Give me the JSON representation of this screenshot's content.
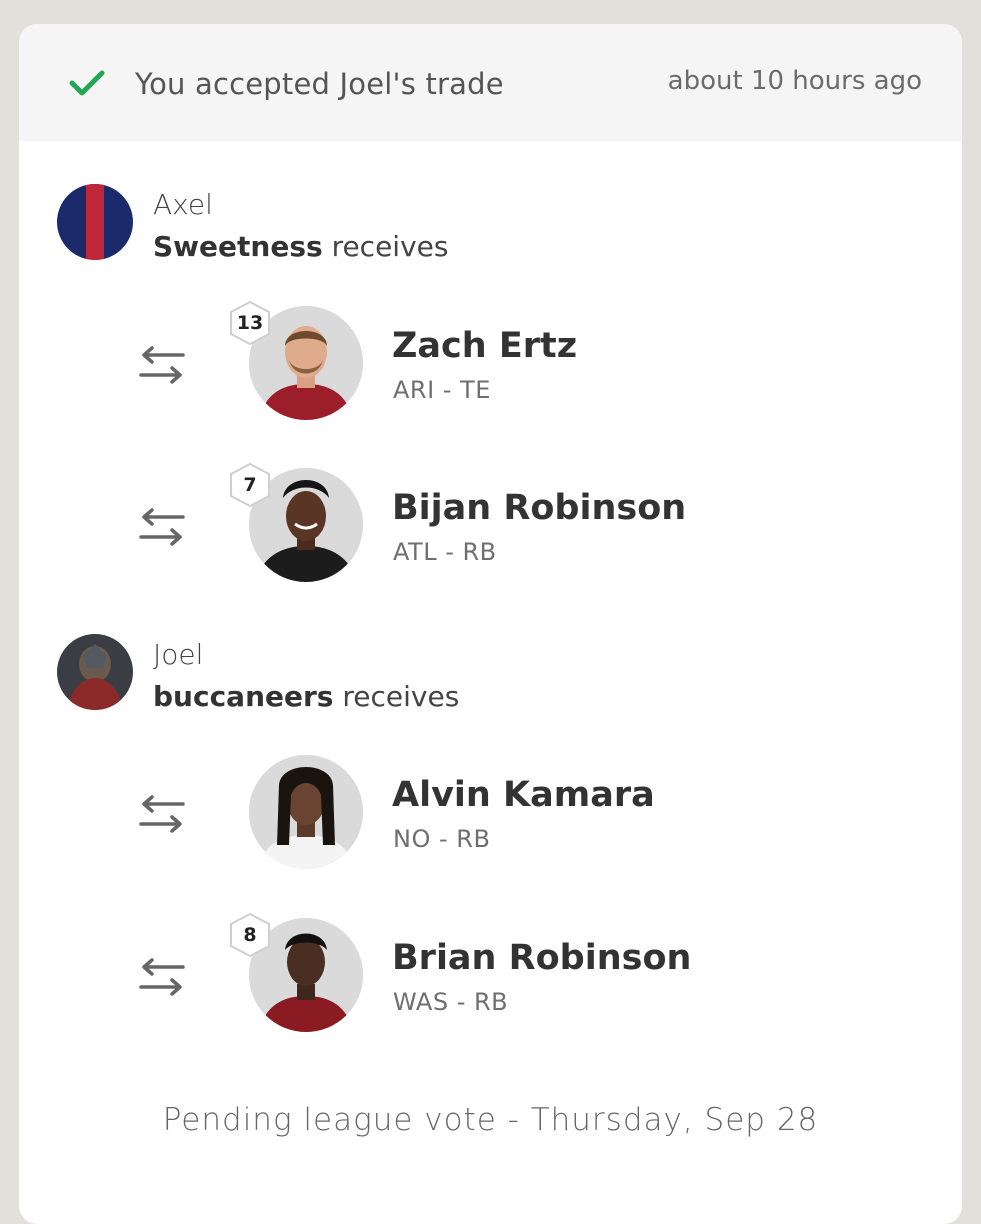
{
  "header": {
    "title": "You accepted Joel's trade",
    "time": "about 10 hours ago",
    "accent_color": "#22a855"
  },
  "teams": [
    {
      "owner": "Axel",
      "team_name": "Sweetness",
      "receives_label": "receives",
      "avatar_icon": "team-stripe-avatar",
      "players": [
        {
          "rank": "13",
          "name": "Zach Ertz",
          "meta": "ARI - TE",
          "icon": "player-photo",
          "jersey_color": "#9b1e2a"
        },
        {
          "rank": "7",
          "name": "Bijan Robinson",
          "meta": "ATL - RB",
          "icon": "player-photo",
          "jersey_color": "#1a1a1a"
        }
      ]
    },
    {
      "owner": "Joel",
      "team_name": "buccaneers",
      "receives_label": "receives",
      "avatar_icon": "warrior-avatar",
      "players": [
        {
          "rank": "",
          "name": "Alvin Kamara",
          "meta": "NO - RB",
          "icon": "player-photo",
          "jersey_color": "#ffffff"
        },
        {
          "rank": "8",
          "name": "Brian Robinson",
          "meta": "WAS - RB",
          "icon": "player-photo",
          "jersey_color": "#8a1b23"
        }
      ]
    }
  ],
  "footer": {
    "status": "Pending league vote - Thursday, Sep 28"
  }
}
